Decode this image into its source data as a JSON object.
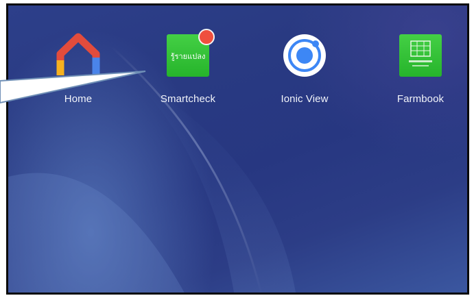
{
  "home_screen": {
    "apps": [
      {
        "label": "Home",
        "icon": "google-home-icon"
      },
      {
        "label": "Smartcheck",
        "icon": "smartcheck-icon",
        "icon_text": "รู้รายแปลง",
        "has_notification_badge": true
      },
      {
        "label": "Ionic View",
        "icon": "ionic-view-icon"
      },
      {
        "label": "Farmbook",
        "icon": "farmbook-icon"
      }
    ]
  },
  "colors": {
    "callout": "#6f8fb6",
    "tile_green": "#2fbf33",
    "badge_red": "#ef4f3e",
    "ionic_blue": "#3d87f5"
  }
}
